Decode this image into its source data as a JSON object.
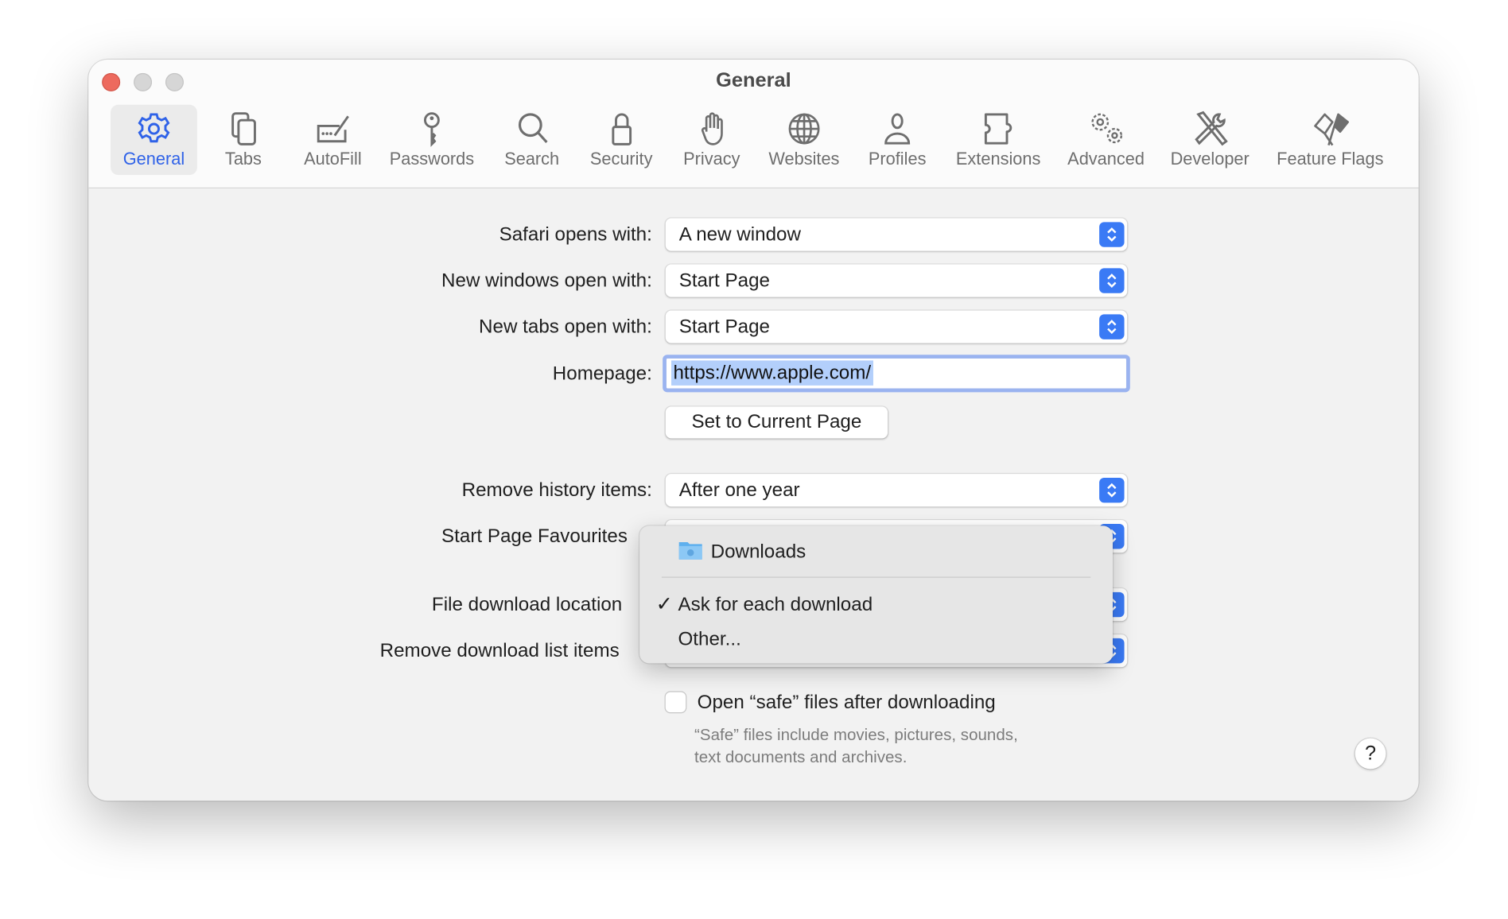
{
  "window": {
    "title": "General"
  },
  "toolbar": {
    "items": [
      {
        "label": "General",
        "icon": "gear-icon",
        "selected": true
      },
      {
        "label": "Tabs",
        "icon": "tabs-icon"
      },
      {
        "label": "AutoFill",
        "icon": "autofill-icon"
      },
      {
        "label": "Passwords",
        "icon": "key-icon"
      },
      {
        "label": "Search",
        "icon": "magnifier-icon"
      },
      {
        "label": "Security",
        "icon": "lock-icon"
      },
      {
        "label": "Privacy",
        "icon": "hand-icon"
      },
      {
        "label": "Websites",
        "icon": "globe-icon"
      },
      {
        "label": "Profiles",
        "icon": "person-icon"
      },
      {
        "label": "Extensions",
        "icon": "puzzle-icon"
      },
      {
        "label": "Advanced",
        "icon": "gears-icon"
      },
      {
        "label": "Developer",
        "icon": "tools-icon"
      },
      {
        "label": "Feature Flags",
        "icon": "flags-icon"
      }
    ],
    "accent": "#2f62e8"
  },
  "form": {
    "safari_opens": {
      "label": "Safari opens with:",
      "value": "A new window"
    },
    "new_windows": {
      "label": "New windows open with:",
      "value": "Start Page"
    },
    "new_tabs": {
      "label": "New tabs open with:",
      "value": "Start Page"
    },
    "homepage": {
      "label": "Homepage:",
      "value": "https://www.apple.com/"
    },
    "set_current": "Set to Current Page",
    "remove_history": {
      "label": "Remove history items:",
      "value": "After one year"
    },
    "favourites": {
      "label": "Start Page Favourites"
    },
    "download_location": {
      "label": "File download location"
    },
    "remove_downloads": {
      "label": "Remove download list items"
    },
    "open_safe": {
      "label": "Open “safe” files after downloading",
      "checked": false
    },
    "note_line1": "“Safe” files include movies, pictures, sounds,",
    "note_line2": "text documents and archives.",
    "help": "?"
  },
  "menu": {
    "items": [
      {
        "label": "Downloads",
        "icon": "downloads-folder-icon"
      },
      {
        "label": "Ask for each download",
        "checked": true
      },
      {
        "label": "Other..."
      }
    ],
    "checkmark": "✓"
  }
}
